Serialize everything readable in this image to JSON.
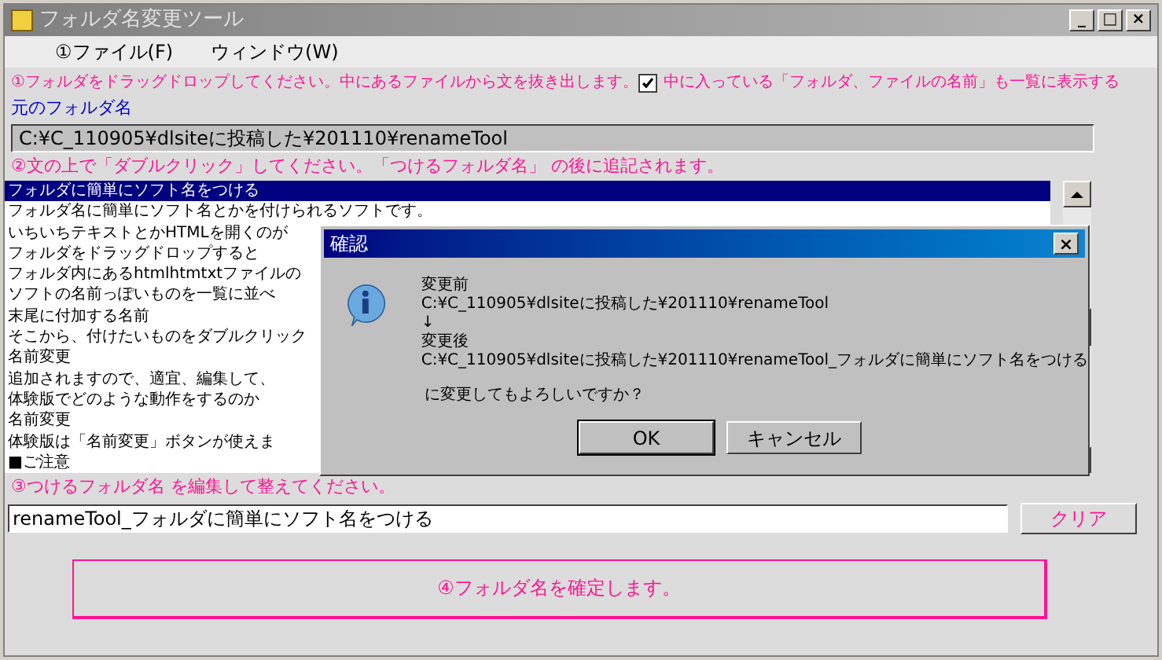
{
  "window": {
    "title": "フォルダ名変更ツール",
    "controls": [
      "_",
      "□",
      "×"
    ]
  },
  "menu": [
    {
      "label": "①ファイル(F)"
    },
    {
      "label": "ウィンドウ(W)"
    }
  ],
  "step1": "①フォルダをドラッグドロップしてください。中にあるファイルから文を抜き出します。",
  "show_names": {
    "label": "中に入っている「フォルダ、ファイルの名前」も一覧に表示する",
    "checked": true
  },
  "source_label": "元のフォルダ名",
  "source_path": "C:¥C_110905¥dlsiteに投稿した¥201110¥renameTool",
  "step2": "②文の上で「ダブルクリック」してください。「つけるフォルダ名」 の後に追記されます。",
  "list": [
    {
      "text": "フォルダに簡単にソフト名をつける",
      "selected": true
    },
    {
      "text": "フォルダ名に簡単にソフト名とかを付けられるソフトです。",
      "selected": false
    },
    {
      "text": "いちいちテキストとかHTMLを開くのが",
      "selected": false
    },
    {
      "text": "フォルダをドラッグドロップすると",
      "selected": false
    },
    {
      "text": "フォルダ内にあるhtmlhtmtxtファイルの",
      "selected": false
    },
    {
      "text": "ソフトの名前っぽいものを一覧に並べ",
      "selected": false
    },
    {
      "text": "末尾に付加する名前",
      "selected": false
    },
    {
      "text": "そこから、付けたいものをダブルクリック",
      "selected": false
    },
    {
      "text": "名前変更",
      "selected": false
    },
    {
      "text": "追加されますので、適宜、編集して、",
      "selected": false
    },
    {
      "text": "体験版でどのような動作をするのか",
      "selected": false
    },
    {
      "text": "名前変更",
      "selected": false
    },
    {
      "text": "体験版は「名前変更」ボタンが使えま",
      "selected": false
    },
    {
      "text": "■ご注意",
      "selected": false
    }
  ],
  "step3": "③つけるフォルダ名 を編集して整えてください。",
  "new_name": "renameTool_フォルダに簡単にソフト名をつける",
  "clear_button": "クリア",
  "confirm_button": "④フォルダ名を確定します。",
  "dialog": {
    "title": "確認",
    "close": "×",
    "lines": [
      "変更前",
      "C:¥C_110905¥dlsiteに投稿した¥201110¥renameTool",
      "↓",
      "変更後",
      "C:¥C_110905¥dlsiteに投稿した¥201110¥renameTool_フォルダに簡単にソフト名をつける"
    ],
    "question": "に変更してもよろしいですか？",
    "buttons": [
      "OK",
      "キャンセル"
    ]
  }
}
